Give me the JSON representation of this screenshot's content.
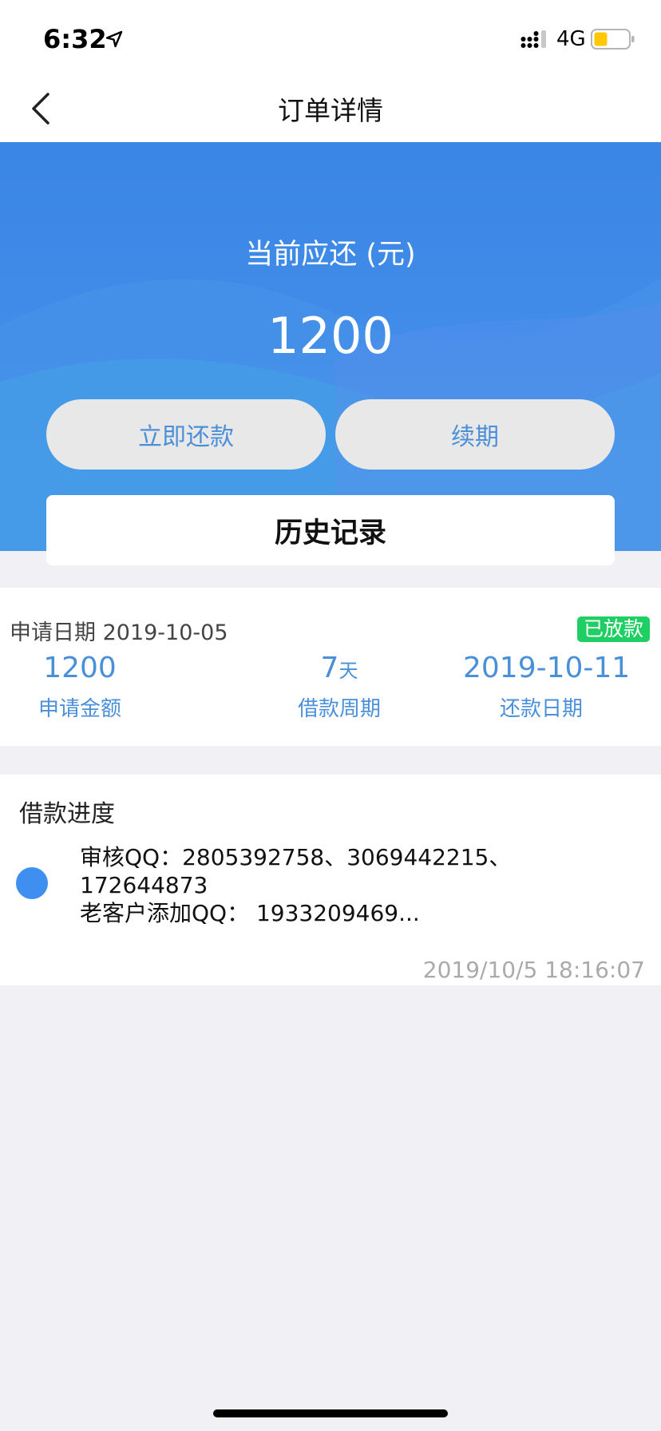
{
  "status_bar": {
    "time": "6:32",
    "network": "4G",
    "battery_color": "#ffc800"
  },
  "nav": {
    "title": "订单详情"
  },
  "hero": {
    "caption": "当前应还 (元)",
    "amount": "1200",
    "repay_button": "立即还款",
    "renew_button": "续期",
    "history_button": "历史记录"
  },
  "summary": {
    "apply_date_label": "申请日期",
    "apply_date": "2019-10-05",
    "status": "已放款",
    "amount_value": "1200",
    "amount_label": "申请金额",
    "period_value": "7",
    "period_unit": "天",
    "period_label": "借款周期",
    "due_value": "2019-10-11",
    "due_label": "还款日期"
  },
  "progress": {
    "title": "借款进度",
    "line1": "审核QQ：2805392758、3069442215、",
    "line2": "172644873",
    "line3": "老客户添加QQ： 1933209469...",
    "time": "2019/10/5 18:16:07"
  },
  "colors": {
    "accent": "#3a86e6",
    "badge": "#1fcf63",
    "link": "#4a90d9"
  }
}
